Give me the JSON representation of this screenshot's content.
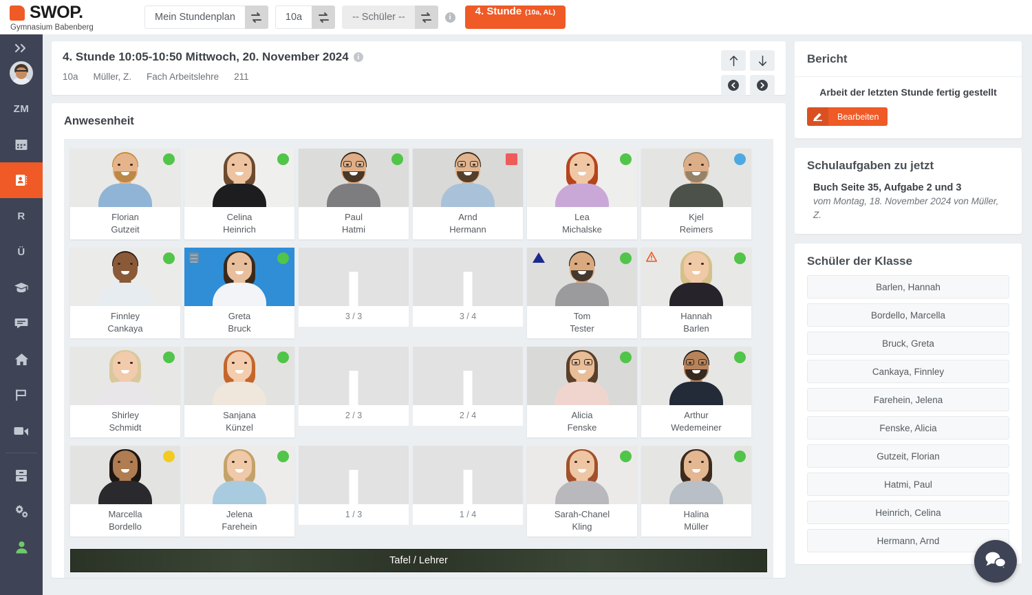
{
  "brand": {
    "name": "SWOP.",
    "subtitle": "Gymnasium Babenberg",
    "mark_color": "#ef5a26"
  },
  "topbar": {
    "schedule_field": "Mein Stundenplan",
    "class_field": "10a",
    "student_field": "-- Schüler --",
    "info_label": "i",
    "hour_button": "4. Stunde",
    "hour_button_small": "(10a, AL)"
  },
  "sidebar": {
    "items": [
      {
        "name": "expand",
        "icon": "chevron-double-right-icon",
        "label": ""
      },
      {
        "name": "profile",
        "icon": "user-avatar",
        "label": ""
      },
      {
        "name": "zm",
        "icon": "text-icon",
        "label": "ZM"
      },
      {
        "name": "calendar",
        "icon": "calendar-icon",
        "label": ""
      },
      {
        "name": "attendance",
        "icon": "contact-card-icon",
        "label": ""
      },
      {
        "name": "r",
        "icon": "text-icon",
        "label": "R"
      },
      {
        "name": "u",
        "icon": "text-icon",
        "label": "Ü"
      },
      {
        "name": "graduation",
        "icon": "graduation-cap-icon",
        "label": ""
      },
      {
        "name": "messages",
        "icon": "chat-icon",
        "label": ""
      },
      {
        "name": "home",
        "icon": "home-icon",
        "label": ""
      },
      {
        "name": "flag",
        "icon": "flag-icon",
        "label": ""
      },
      {
        "name": "video",
        "icon": "video-camera-icon",
        "label": ""
      },
      {
        "name": "archive",
        "icon": "archive-icon",
        "label": ""
      },
      {
        "name": "settings",
        "icon": "gears-icon",
        "label": ""
      },
      {
        "name": "account",
        "icon": "person-icon",
        "label": ""
      }
    ]
  },
  "lesson": {
    "title": "4. Stunde 10:05-10:50 Mittwoch, 20. November 2024",
    "info_label": "i",
    "meta": [
      "10a",
      "Müller, Z.",
      "Fach Arbeitslehre",
      "211"
    ],
    "nav": [
      {
        "name": "up",
        "glyph": "↑"
      },
      {
        "name": "down",
        "glyph": "↓"
      },
      {
        "name": "previous",
        "glyph": "prev-circle-icon"
      },
      {
        "name": "next",
        "glyph": "next-circle-icon"
      }
    ]
  },
  "attendance": {
    "title": "Anwesenheit",
    "board_label": "Tafel / Lehrer",
    "rows": [
      [
        {
          "type": "student",
          "first": "Florian",
          "last": "Gutzeit",
          "status": "green"
        },
        {
          "type": "student",
          "first": "Celina",
          "last": "Heinrich",
          "status": "green"
        },
        {
          "type": "student",
          "first": "Paul",
          "last": "Hatmi",
          "status": "green"
        },
        {
          "type": "student",
          "first": "Arnd",
          "last": "Hermann",
          "status": "red-square"
        },
        {
          "type": "student",
          "first": "Lea",
          "last": "Michalske",
          "status": "green"
        },
        {
          "type": "student",
          "first": "Kjel",
          "last": "Reimers",
          "status": "blue"
        }
      ],
      [
        {
          "type": "student",
          "first": "Finnley",
          "last": "Cankaya",
          "status": "green"
        },
        {
          "type": "student",
          "first": "Greta",
          "last": "Bruck",
          "status": "green",
          "mark": "note",
          "selected": true
        },
        {
          "type": "empty",
          "label": "3 / 3"
        },
        {
          "type": "empty",
          "label": "3 / 4"
        },
        {
          "type": "student",
          "first": "Tom",
          "last": "Tester",
          "status": "green",
          "mark": "triangle"
        },
        {
          "type": "student",
          "first": "Hannah",
          "last": "Barlen",
          "status": "green",
          "mark": "warning"
        }
      ],
      [
        {
          "type": "student",
          "first": "Shirley",
          "last": "Schmidt",
          "status": "green"
        },
        {
          "type": "student",
          "first": "Sanjana",
          "last": "Künzel",
          "status": "green"
        },
        {
          "type": "empty",
          "label": "2 / 3"
        },
        {
          "type": "empty",
          "label": "2 / 4"
        },
        {
          "type": "student",
          "first": "Alicia",
          "last": "Fenske",
          "status": "green"
        },
        {
          "type": "student",
          "first": "Arthur",
          "last": "Wedemeiner",
          "status": "green"
        }
      ],
      [
        {
          "type": "student",
          "first": "Marcella",
          "last": "Bordello",
          "status": "yellow"
        },
        {
          "type": "student",
          "first": "Jelena",
          "last": "Farehein",
          "status": "green"
        },
        {
          "type": "empty",
          "label": "1 / 3"
        },
        {
          "type": "empty",
          "label": "1 / 4"
        },
        {
          "type": "student",
          "first": "Sarah-Chanel",
          "last": "Kling",
          "status": "green"
        },
        {
          "type": "student",
          "first": "Halina",
          "last": "Müller",
          "status": "green"
        }
      ]
    ]
  },
  "report": {
    "title": "Bericht",
    "text": "Arbeit der letzten Stunde fertig gestellt",
    "edit_label": "Bearbeiten"
  },
  "homework": {
    "title": "Schulaufgaben zu jetzt",
    "item_title": "Buch Seite 35, Aufgabe 2 und 3",
    "item_sub": "vom Montag, 18. November 2024 von Müller, Z."
  },
  "class_students": {
    "title": "Schüler der Klasse",
    "items": [
      "Barlen, Hannah",
      "Bordello, Marcella",
      "Bruck, Greta",
      "Cankaya, Finnley",
      "Farehein, Jelena",
      "Fenske, Alicia",
      "Gutzeit, Florian",
      "Hatmi, Paul",
      "Heinrich, Celina",
      "Hermann, Arnd"
    ]
  },
  "chat": {
    "icon": "chat-bubbles-icon"
  },
  "colors": {
    "accent": "#ef5a26",
    "sidebar": "#3e4355",
    "status_present": "#51c44a",
    "status_absent": "#ef5a5a",
    "status_late": "#f2cb20",
    "status_other": "#4fa9e0"
  }
}
